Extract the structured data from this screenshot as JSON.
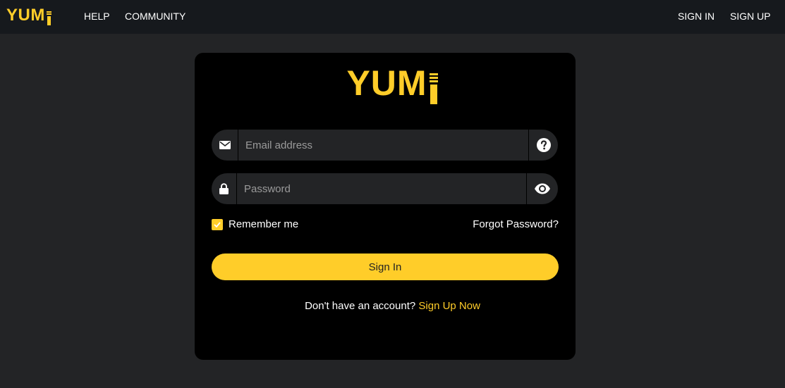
{
  "topbar": {
    "brand": "YUMi",
    "nav": {
      "help": "HELP",
      "community": "COMMUNITY",
      "sign_in": "SIGN IN",
      "sign_up": "SIGN UP"
    }
  },
  "card": {
    "logo": "YUMi",
    "email": {
      "placeholder": "Email address",
      "value": "",
      "prefix_icon": "envelope-icon",
      "suffix_icon": "question-circle-icon"
    },
    "password": {
      "placeholder": "Password",
      "value": "",
      "prefix_icon": "lock-icon",
      "suffix_icon": "eye-icon"
    },
    "remember": {
      "label": "Remember me",
      "checked": true
    },
    "forgot_password": "Forgot Password?",
    "sign_in_button": "Sign In",
    "signup_prompt": "Don't have an account?",
    "signup_link": "Sign Up Now"
  },
  "colors": {
    "accent": "#ffcd29",
    "page_bg": "#232426",
    "topbar_bg": "#16191d",
    "card_bg": "#000000"
  }
}
